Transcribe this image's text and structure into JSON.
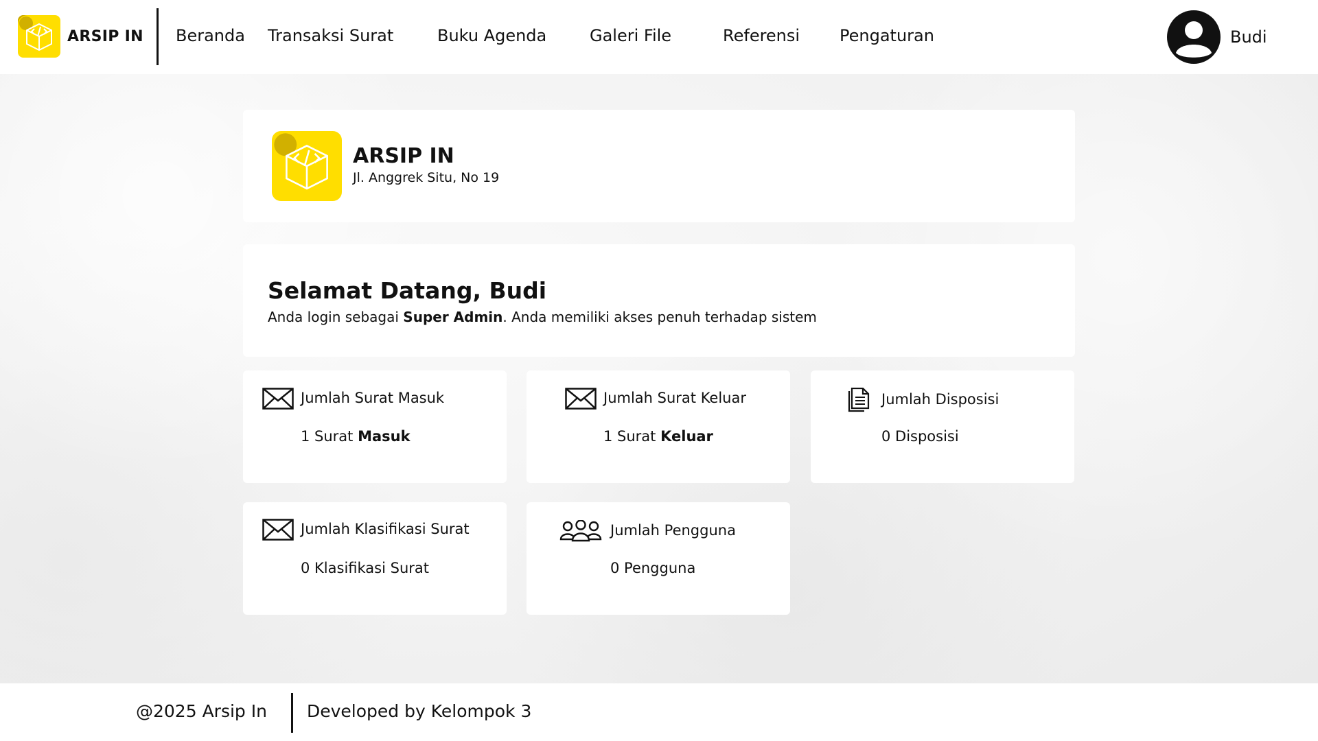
{
  "app": {
    "name": "ARSIP IN"
  },
  "nav": [
    "Beranda",
    "Transaksi Surat",
    "Buku Agenda",
    "Galeri File",
    "Referensi",
    "Pengaturan"
  ],
  "user": {
    "name": "Budi",
    "avatar_icon": "user-circle-icon"
  },
  "profile": {
    "title": "ARSIP IN",
    "address": "Jl. Anggrek Situ, No 19"
  },
  "welcome": {
    "heading": "Selamat Datang, Budi",
    "prefix": "Anda login sebagai ",
    "role": "Super Admin",
    "suffix": ". Anda memiliki akses penuh terhadap sistem"
  },
  "stats": [
    {
      "label": "Jumlah Surat Masuk",
      "count": "1 Surat ",
      "bold": "Masuk",
      "icon": "envelope-icon"
    },
    {
      "label": "Jumlah Surat Keluar",
      "count": "1 Surat ",
      "bold": "Keluar",
      "icon": "envelope-icon"
    },
    {
      "label": "Jumlah Disposisi",
      "count": "0 Disposisi",
      "bold": "",
      "icon": "document-icon"
    },
    {
      "label": "Jumlah Klasifikasi Surat",
      "count": "0 Klasifikasi Surat",
      "bold": "",
      "icon": "envelope-icon"
    },
    {
      "label": "Jumlah Pengguna",
      "count": "0 Pengguna",
      "bold": "",
      "icon": "users-icon"
    }
  ],
  "footer": {
    "copyright": "@2025 Arsip In",
    "developer": "Developed by Kelompok 3"
  },
  "colors": {
    "accent": "#FFDE00",
    "accent_dark": "#C9A800",
    "text": "#111111",
    "card": "#FFFFFF"
  }
}
